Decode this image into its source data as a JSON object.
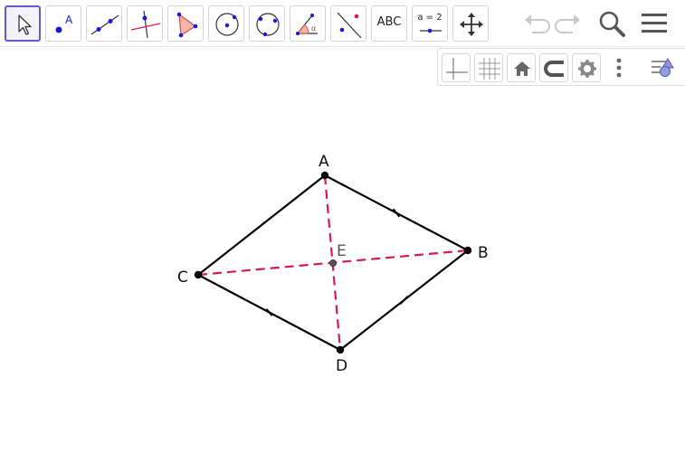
{
  "toolbar": {
    "tools": [
      {
        "name": "move-tool",
        "selected": true
      },
      {
        "name": "point-tool",
        "icon_label": "A"
      },
      {
        "name": "line-tool"
      },
      {
        "name": "perpendicular-line-tool"
      },
      {
        "name": "polygon-tool"
      },
      {
        "name": "circle-center-point-tool"
      },
      {
        "name": "circle-three-points-tool"
      },
      {
        "name": "angle-tool",
        "icon_label": "α"
      },
      {
        "name": "reflect-tool"
      },
      {
        "name": "text-tool",
        "label": "ABC"
      },
      {
        "name": "slider-tool",
        "label": "a = 2"
      },
      {
        "name": "move-graphics-view-tool"
      }
    ],
    "undo": "undo-icon",
    "redo": "redo-icon",
    "search": "search-icon",
    "menu": "menu-icon"
  },
  "style_bar": {
    "buttons": [
      "axes-icon",
      "grid-icon",
      "home-icon",
      "point-capturing-icon",
      "settings-icon",
      "more-vertical-icon",
      "toggle-style-bar-icon"
    ]
  },
  "construction": {
    "points": [
      {
        "label": "A",
        "name": "point-A"
      },
      {
        "label": "B",
        "name": "point-B"
      },
      {
        "label": "C",
        "name": "point-C"
      },
      {
        "label": "D",
        "name": "point-D"
      },
      {
        "label": "E",
        "name": "point-E"
      }
    ],
    "sides": [
      "AB",
      "BD",
      "DC",
      "CA"
    ],
    "diagonals": [
      "AD",
      "CB"
    ],
    "colors": {
      "sides": "#000000",
      "diagonals": "#d7194f",
      "points": "#000000",
      "intersection_point": "#555555",
      "accent": "#6557d2"
    }
  }
}
